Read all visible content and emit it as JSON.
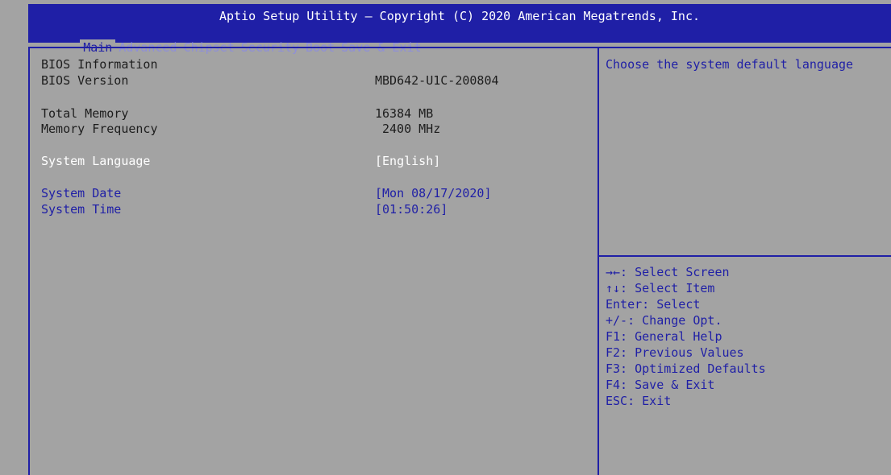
{
  "header": {
    "title": "Aptio Setup Utility – Copyright (C) 2020 American Megatrends, Inc.",
    "tabs": [
      "Main",
      "Advanced",
      "Chipset",
      "Security",
      "Boot",
      "Save & Exit"
    ],
    "active_tab": "Main"
  },
  "main": {
    "bios_info_label": "BIOS Information",
    "bios_version": {
      "label": "BIOS Version",
      "value": "MBD642-U1C-200804"
    },
    "total_memory": {
      "label": "Total Memory",
      "value": "16384 MB"
    },
    "memory_frequency": {
      "label": "Memory Frequency",
      "value": "2400 MHz"
    },
    "system_language": {
      "label": "System Language",
      "value": "[English]"
    },
    "system_date": {
      "label": "System Date",
      "value": "[Mon 08/17/2020]"
    },
    "system_time": {
      "label": "System Time",
      "value": "[01:50:26]"
    }
  },
  "help": {
    "description": "Choose the system default language",
    "keys": [
      "→←: Select Screen",
      "↑↓: Select Item",
      "Enter: Select",
      "+/-: Change Opt.",
      "F1: General Help",
      "F2: Previous Values",
      "F3: Optimized Defaults",
      "F4: Save & Exit",
      "ESC: Exit"
    ]
  },
  "colors": {
    "background": "#a3a3a3",
    "accent_blue": "#1f1fa6",
    "selected_text": "#ffffff"
  }
}
